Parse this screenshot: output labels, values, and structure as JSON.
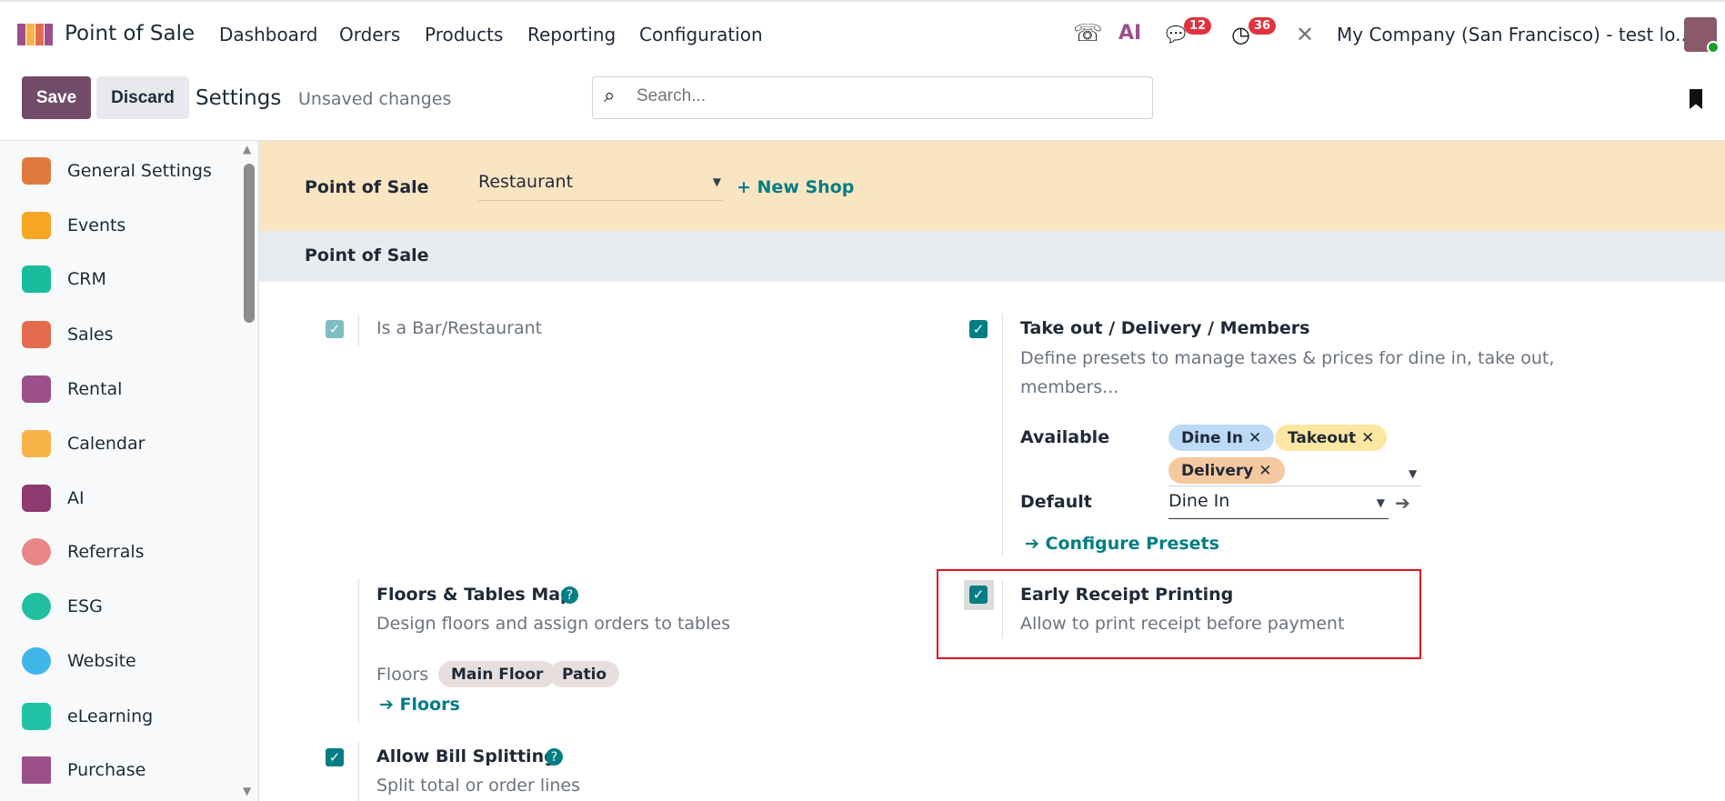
{
  "navbar": {
    "app_name": "Point of Sale",
    "menus": [
      "Dashboard",
      "Orders",
      "Products",
      "Reporting",
      "Configuration"
    ],
    "messages_count": "12",
    "activities_count": "36",
    "company": "My Company (San Francisco) - test lo...",
    "ai_label": "AI"
  },
  "control_panel": {
    "save": "Save",
    "discard": "Discard",
    "title": "Settings",
    "status": "Unsaved changes",
    "search_placeholder": "Search..."
  },
  "sidebar": {
    "items": [
      {
        "label": "General Settings",
        "icon": "general-settings",
        "color": "#e07a3c"
      },
      {
        "label": "Events",
        "icon": "events",
        "color": "#f5a623"
      },
      {
        "label": "CRM",
        "icon": "crm",
        "color": "#1abc9c"
      },
      {
        "label": "Sales",
        "icon": "sales",
        "color": "#e46c4e"
      },
      {
        "label": "Rental",
        "icon": "rental",
        "color": "#9b4f8b"
      },
      {
        "label": "Calendar",
        "icon": "calendar",
        "color": "#f7b449"
      },
      {
        "label": "AI",
        "icon": "ai",
        "color": "#8e3a6e"
      },
      {
        "label": "Referrals",
        "icon": "referrals",
        "color": "#e98787"
      },
      {
        "label": "ESG",
        "icon": "esg",
        "color": "#1fbf9f"
      },
      {
        "label": "Website",
        "icon": "website",
        "color": "#3fb5e8"
      },
      {
        "label": "eLearning",
        "icon": "elearning",
        "color": "#22c3a5"
      },
      {
        "label": "Purchase",
        "icon": "purchase",
        "color": "#9b4f8b"
      }
    ]
  },
  "shop_bar": {
    "label": "Point of Sale",
    "selected": "Restaurant",
    "new_shop": "+ New Shop"
  },
  "section": {
    "title": "Point of Sale"
  },
  "settings": {
    "bar_restaurant": {
      "label": "Is a Bar/Restaurant",
      "checked": true
    },
    "takeout": {
      "title": "Take out / Delivery / Members",
      "desc1": "Define presets to manage taxes & prices for dine in, take out,",
      "desc2": "members...",
      "checked": true,
      "available_label": "Available",
      "available": [
        "Dine In",
        "Takeout",
        "Delivery"
      ],
      "default_label": "Default",
      "default": "Dine In",
      "configure": "Configure Presets"
    },
    "floors": {
      "title": "Floors & Tables Map",
      "desc": "Design floors and assign orders to tables",
      "floors_label": "Floors",
      "floors": [
        "Main Floor",
        "Patio"
      ],
      "link": "Floors"
    },
    "early_receipt": {
      "title": "Early Receipt Printing",
      "desc": "Allow to print receipt before payment",
      "checked": true
    },
    "bill_split": {
      "title": "Allow Bill Splitting",
      "desc": "Split total or order lines",
      "checked": true
    }
  },
  "colors": {
    "primary": "#714b67",
    "accent": "#017e84",
    "highlight": "#e0131d"
  }
}
